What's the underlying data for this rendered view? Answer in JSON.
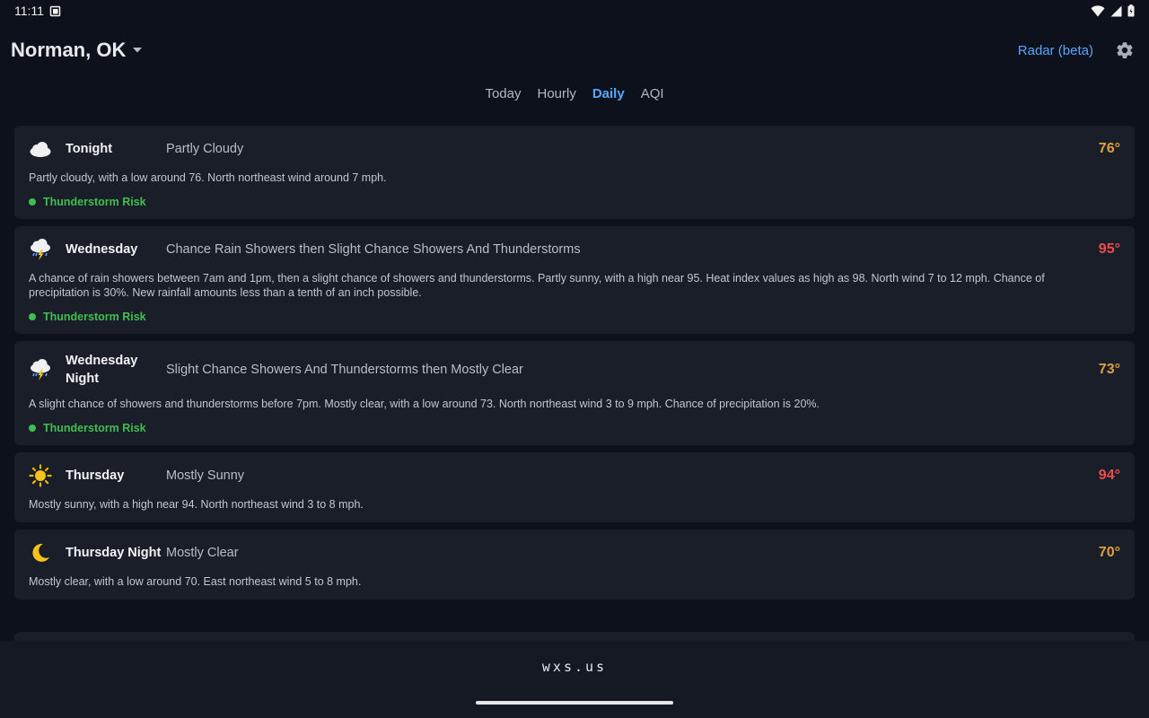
{
  "status": {
    "time": "11:11"
  },
  "header": {
    "location": "Norman, OK",
    "radar_label": "Radar (beta)"
  },
  "tabs": [
    {
      "label": "Today",
      "active": false
    },
    {
      "label": "Hourly",
      "active": false
    },
    {
      "label": "Daily",
      "active": true
    },
    {
      "label": "AQI",
      "active": false
    }
  ],
  "colors": {
    "accent": "#5aa7ff",
    "temp_low": "#e0a13a",
    "temp_high": "#ef4b4b",
    "risk": "#3fbf4f"
  },
  "periods": [
    {
      "icon": "partly-cloudy-icon",
      "period": "Tonight",
      "short": "Partly Cloudy",
      "temp": "76°",
      "temp_kind": "low",
      "desc": "Partly cloudy, with a low around 76. North northeast wind around 7 mph.",
      "risk": "Thunderstorm Risk"
    },
    {
      "icon": "thunderstorm-icon",
      "period": "Wednesday",
      "short": "Chance Rain Showers then Slight Chance Showers And Thunderstorms",
      "temp": "95°",
      "temp_kind": "high",
      "desc": "A chance of rain showers between 7am and 1pm, then a slight chance of showers and thunderstorms. Partly sunny, with a high near 95. Heat index values as high as 98. North wind 7 to 12 mph. Chance of precipitation is 30%. New rainfall amounts less than a tenth of an inch possible.",
      "risk": "Thunderstorm Risk"
    },
    {
      "icon": "thunderstorm-icon",
      "period": "Wednesday Night",
      "short": "Slight Chance Showers And Thunderstorms then Mostly Clear",
      "temp": "73°",
      "temp_kind": "low",
      "desc": "A slight chance of showers and thunderstorms before 7pm. Mostly clear, with a low around 73. North northeast wind 3 to 9 mph. Chance of precipitation is 20%.",
      "risk": "Thunderstorm Risk"
    },
    {
      "icon": "sun-icon",
      "period": "Thursday",
      "short": "Mostly Sunny",
      "temp": "94°",
      "temp_kind": "high",
      "desc": "Mostly sunny, with a high near 94. North northeast wind 3 to 8 mph.",
      "risk": ""
    },
    {
      "icon": "moon-icon",
      "period": "Thursday Night",
      "short": "Mostly Clear",
      "temp": "70°",
      "temp_kind": "low",
      "desc": "Mostly clear, with a low around 70. East northeast wind 5 to 8 mph.",
      "risk": ""
    }
  ],
  "footer": {
    "brand": "wxs.us"
  }
}
